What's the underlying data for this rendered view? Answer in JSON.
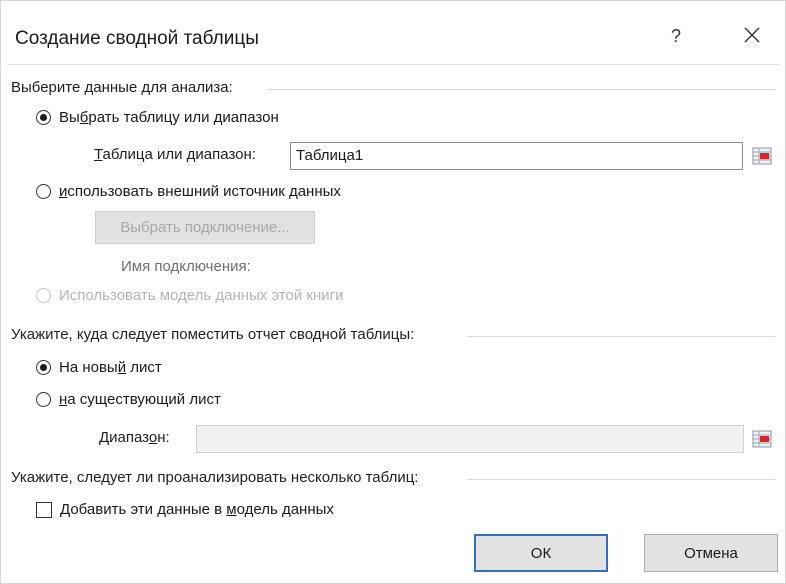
{
  "window": {
    "title": "Создание сводной таблицы",
    "help_label": "?",
    "close_icon": "close-icon"
  },
  "section_source": {
    "label": "Выберите данные для анализа:",
    "option_range": {
      "pre": "Вы",
      "u": "б",
      "post": "рать таблицу или диапазон",
      "checked": true
    },
    "range_label": {
      "u": "Т",
      "post": "аблица или диапазон:"
    },
    "range_value": "Таблица1",
    "option_external": {
      "u": "и",
      "post": "спользовать внешний источник данных",
      "checked": false
    },
    "choose_connection_label": "Выбрать подключение...",
    "connection_name_label": "Имя подключения:",
    "option_data_model": {
      "label": "Использовать модель данных этой книги",
      "enabled": false
    }
  },
  "section_destination": {
    "label": "Укажите, куда следует поместить отчет сводной таблицы:",
    "option_new_sheet": {
      "pre": "На новы",
      "u": "й",
      "post": " лист",
      "checked": true
    },
    "option_existing_sheet": {
      "u": "н",
      "post": "а существующий лист",
      "checked": false
    },
    "location_label": {
      "pre": "Диапаз",
      "u": "о",
      "post": "н:"
    },
    "location_value": ""
  },
  "section_multiple": {
    "label": "Укажите, следует ли проанализировать несколько таблиц:",
    "add_to_model": {
      "pre": "Добавить эти данные в ",
      "u": "м",
      "post": "одель данных",
      "checked": false
    }
  },
  "buttons": {
    "ok": "ОК",
    "cancel": "Отмена"
  },
  "colors": {
    "default_button_border": "#2f6fbf",
    "ref_icon_red": "#d9262b"
  }
}
